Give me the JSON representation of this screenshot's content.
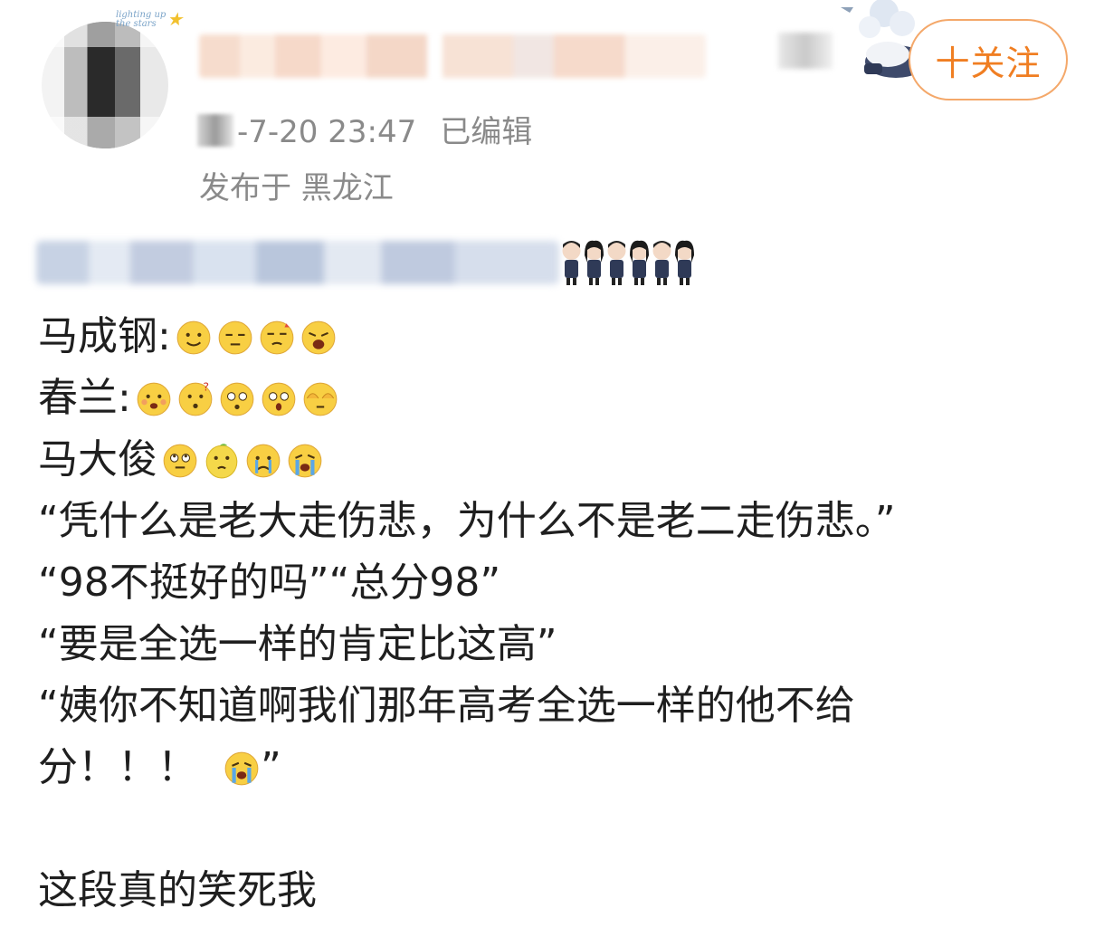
{
  "header": {
    "follow_label": "十关注",
    "timestamp": "-7-20 23:47",
    "edited_label": "已编辑",
    "location": "发布于 黑龙江",
    "avatar_badge_text": "lighting up the stars"
  },
  "body": {
    "lines": {
      "l1": "马成钢:",
      "l2": "春兰:",
      "l3": "马大俊",
      "l4": "“凭什么是老大走伤悲，为什么不是老二走伤悲。”",
      "l5": "“98不挺好的吗”“总分98”",
      "l6": "“要是全选一样的肯定比这高”",
      "l7": "“姨你不知道啊我们那年高考全选一样的他不给",
      "l8a": "分！！！",
      "l8b": "”",
      "l9": "这段真的笑死我"
    },
    "emoji": {
      "l1": [
        "smile-emoji-icon",
        "speechless-emoji-icon",
        "annoyed-emoji-icon",
        "yawn-emoji-icon"
      ],
      "l2": [
        "blush-emoji-icon",
        "confused-emoji-icon",
        "stunned-emoji-icon",
        "shocked-emoji-icon",
        "cover-face-emoji-icon"
      ],
      "l3": [
        "eye-roll-emoji-icon",
        "lemon-emoji-icon",
        "tearful-emoji-icon",
        "crying-emoji-icon"
      ],
      "l8": [
        "crying-emoji-icon"
      ]
    }
  },
  "colors": {
    "accent": "#f07e22",
    "follow_border": "#f4a86a",
    "meta_text": "#8a8a8a",
    "body_text": "#1f1f1f",
    "emoji_yellow": "#f8cf43"
  }
}
